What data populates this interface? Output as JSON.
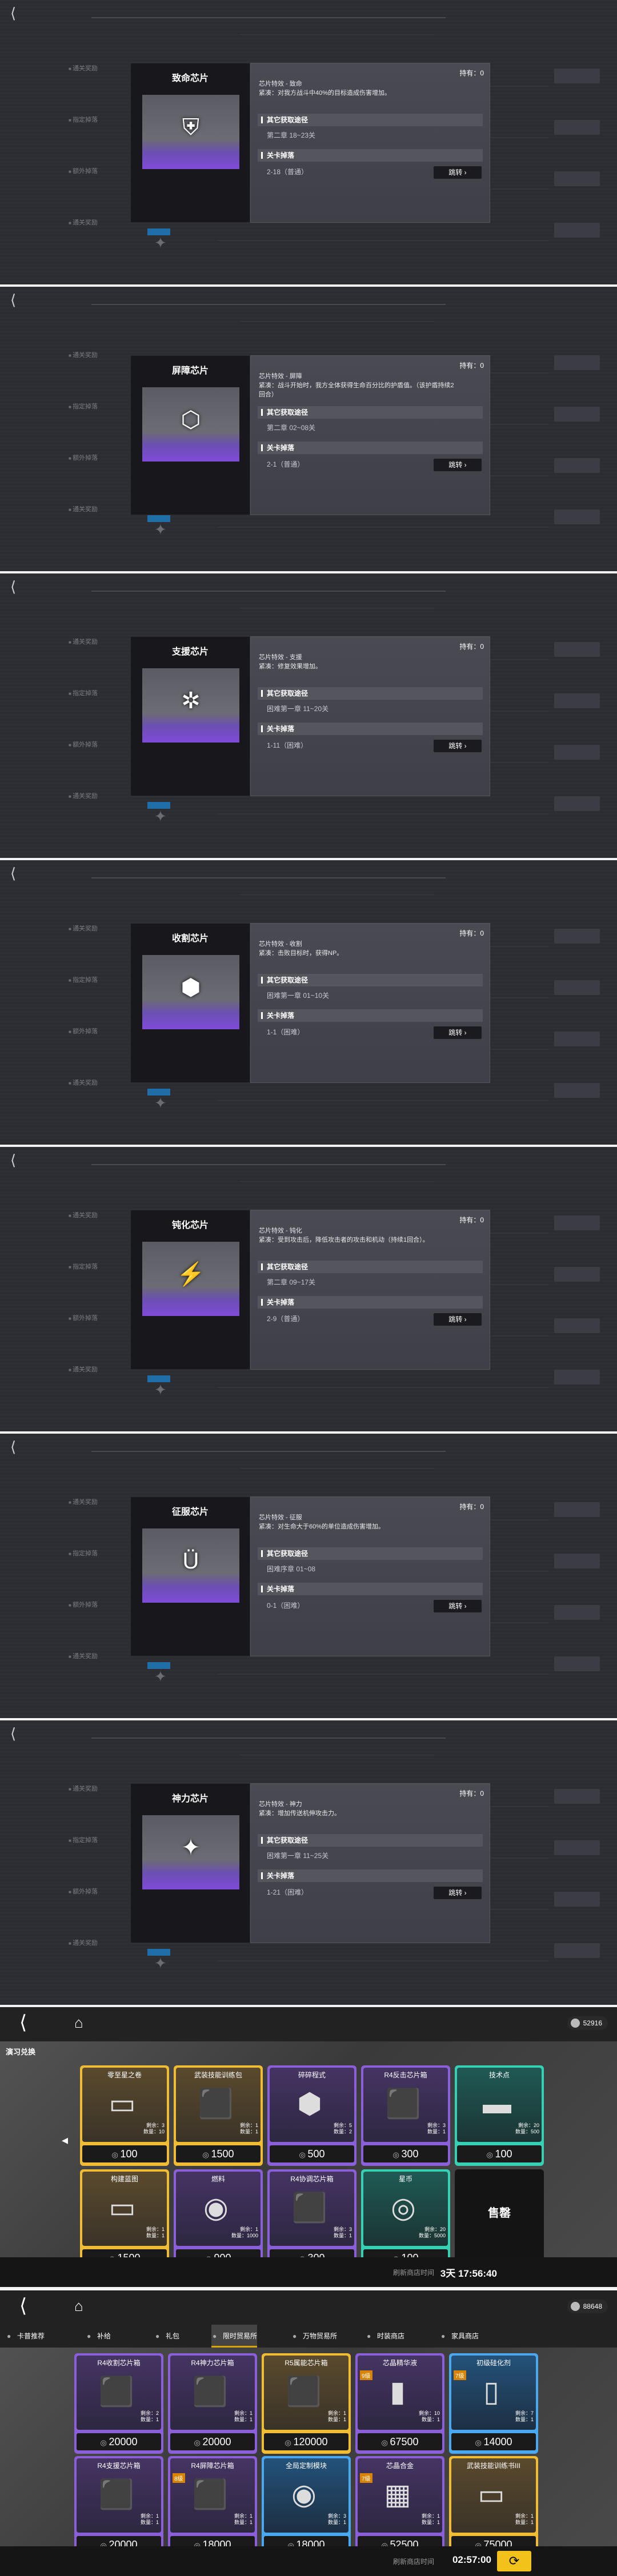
{
  "chips": [
    {
      "title": "致命芯片",
      "owned": "持有：0",
      "desc": "芯片特效 - 致命\n紧凑：对我方战斗中40%的目标造成伤害增加。",
      "other_label": "其它获取途径",
      "other_value": "第二章 18~23关",
      "drop_label": "关卡掉落",
      "drop_value": "2-18（普通）",
      "jump": "跳转",
      "icon": "sword-chip-icon",
      "glyph": "⛨"
    },
    {
      "title": "屏障芯片",
      "owned": "持有：0",
      "desc": "芯片特效 - 屏障\n紧凑：战斗开始时，我方全体获得生命百分比的护盾值。（该护盾持续2回合）",
      "other_label": "其它获取途径",
      "other_value": "第二章 02~08关",
      "drop_label": "关卡掉落",
      "drop_value": "2-1（普通）",
      "jump": "跳转",
      "icon": "shield-chip-icon",
      "glyph": "⬡"
    },
    {
      "title": "支援芯片",
      "owned": "持有：0",
      "desc": "芯片特效 - 支援\n紧凑：修复效果增加。",
      "other_label": "其它获取途径",
      "other_value": "困难第一章 11~20关",
      "drop_label": "关卡掉落",
      "drop_value": "1-11（困难）",
      "jump": "跳转",
      "icon": "support-chip-icon",
      "glyph": "✲"
    },
    {
      "title": "收割芯片",
      "owned": "持有：0",
      "desc": "芯片特效 - 收割\n紧凑：击败目标时，获得NP。",
      "other_label": "其它获取途径",
      "other_value": "困难第一章 01~10关",
      "drop_label": "关卡掉落",
      "drop_value": "1-1（困难）",
      "jump": "跳转",
      "icon": "harvest-chip-icon",
      "glyph": "⬢"
    },
    {
      "title": "钝化芯片",
      "owned": "持有：0",
      "desc": "芯片特效 - 钝化\n紧凑：受到攻击后，降低攻击者的攻击和机动（持续1回合）。",
      "other_label": "其它获取途径",
      "other_value": "第二章 09~17关",
      "drop_label": "关卡掉落",
      "drop_value": "2-9（普通）",
      "jump": "跳转",
      "icon": "blunt-chip-icon",
      "glyph": "⚡"
    },
    {
      "title": "征服芯片",
      "owned": "持有：0",
      "desc": "芯片特效 - 征服\n紧凑：对生命大于60%的单位造成伤害增加。",
      "other_label": "其它获取途径",
      "other_value": "困难序章 01~08",
      "drop_label": "关卡掉落",
      "drop_value": "0-1（困难）",
      "jump": "跳转",
      "icon": "conquer-chip-icon",
      "glyph": "Ü"
    },
    {
      "title": "神力芯片",
      "owned": "持有：0",
      "desc": "芯片特效 - 神力\n紧凑：增加传送机伸攻击力。",
      "other_label": "其它获取途径",
      "other_value": "困难第一章 11~25关",
      "drop_label": "关卡掉落",
      "drop_value": "1-21（困难）",
      "jump": "跳转",
      "icon": "divine-chip-icon",
      "glyph": "✦"
    }
  ],
  "side_labels": [
    "通关奖励",
    "指定掉落",
    "额外掉落",
    "通关奖励"
  ],
  "store1": {
    "coins": "52916",
    "tab": "演习兑换",
    "items": [
      {
        "name": "零至星之卷",
        "price": "100",
        "color": "gold",
        "stock": "剩余：3\n数量：10",
        "glyph": "▭"
      },
      {
        "name": "武装技能训练包",
        "price": "1500",
        "color": "gold",
        "stock": "剩余：1\n数量：1",
        "glyph": "⬛"
      },
      {
        "name": "碎碎程式",
        "price": "500",
        "color": "purple",
        "stock": "剩余：5\n数量：2",
        "glyph": "⬢"
      },
      {
        "name": "R4反击芯片箱",
        "price": "300",
        "color": "purple",
        "stock": "剩余：3\n数量：1",
        "glyph": "⬛"
      },
      {
        "name": "技术点",
        "price": "100",
        "color": "teal",
        "stock": "剩余：20\n数量：500",
        "glyph": "▬"
      },
      {
        "name": "构建蓝图",
        "price": "1500",
        "color": "gold",
        "stock": "剩余：1\n数量：1",
        "glyph": "▭"
      },
      {
        "name": "燃料",
        "price": "900",
        "color": "purple",
        "stock": "剩余：1\n数量：1000",
        "glyph": "◉"
      },
      {
        "name": "R4协调芯片箱",
        "price": "300",
        "color": "purple",
        "stock": "剩余：3\n数量：1",
        "glyph": "⬛"
      },
      {
        "name": "星币",
        "price": "100",
        "color": "teal",
        "stock": "剩余：20\n数量：5000",
        "glyph": "◎"
      },
      {
        "name": "",
        "price": "",
        "color": "dark",
        "stock": "",
        "glyph": "",
        "sold": "售罄"
      }
    ],
    "refresh_label": "刷新商店时间",
    "refresh_time": "3天  17:56:40"
  },
  "store2": {
    "coins": "88648",
    "tabs": [
      "卡普推荐",
      "补给",
      "礼包",
      "限时贸易所",
      "万物贸易所",
      "时装商店",
      "家具商店"
    ],
    "items": [
      {
        "name": "R4收割芯片箱",
        "price": "20000",
        "color": "purple",
        "stock": "剩余：2\n数量：1",
        "glyph": "⬛",
        "lvl": ""
      },
      {
        "name": "R4神力芯片箱",
        "price": "20000",
        "color": "purple",
        "stock": "剩余：1\n数量：1",
        "glyph": "⬛",
        "lvl": ""
      },
      {
        "name": "R5属能芯片箱",
        "price": "120000",
        "color": "gold",
        "stock": "剩余：1\n数量：1",
        "glyph": "⬛",
        "lvl": ""
      },
      {
        "name": "芯晶精华液",
        "price": "67500",
        "color": "purple",
        "stock": "剩余：10\n数量：1",
        "glyph": "▮",
        "lvl": "9级"
      },
      {
        "name": "初级硅化剂",
        "price": "14000",
        "color": "blue",
        "stock": "剩余：7\n数量：1",
        "glyph": "▯",
        "lvl": "7级"
      },
      {
        "name": "R4支援芯片箱",
        "price": "20000",
        "color": "purple",
        "stock": "剩余：1\n数量：1",
        "glyph": "⬛",
        "lvl": ""
      },
      {
        "name": "R4屏障芯片箱",
        "price": "18000",
        "color": "purple",
        "stock": "剩余：1\n数量：1",
        "glyph": "⬛",
        "lvl": "8级"
      },
      {
        "name": "全局定制模块",
        "price": "18000",
        "color": "blue",
        "stock": "剩余：3\n数量：1",
        "glyph": "◉",
        "lvl": ""
      },
      {
        "name": "芯晶合金",
        "price": "52500",
        "color": "purple",
        "stock": "剩余：1\n数量：1",
        "glyph": "▦",
        "lvl": "7级"
      },
      {
        "name": "武装技能训练书III",
        "price": "75000",
        "color": "gold",
        "stock": "剩余：1\n数量：1",
        "glyph": "▭",
        "lvl": ""
      }
    ],
    "refresh_label": "刷新商店时间",
    "refresh_time": "02:57:00"
  }
}
